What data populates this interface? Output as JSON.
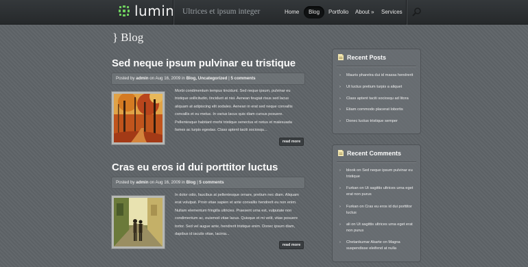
{
  "header": {
    "logo": "lumin",
    "tagline": "Ultrices et ipsum integer",
    "nav": [
      "Home",
      "Blog",
      "Portfolio",
      "About »",
      "Services"
    ],
    "active_nav": "Blog",
    "search_icon": "magnifier-icon"
  },
  "page": {
    "brace": "}",
    "title": "Blog"
  },
  "posts": [
    {
      "title": "Sed neque ipsum pulvinar eu tristique",
      "meta": {
        "posted_by": "Posted by",
        "author": "admin",
        "on": "on Aug 16, 2009 in",
        "categories": "Blog, Uncategorized",
        "sep": "|",
        "comments": "5 comments"
      },
      "excerpt": [
        "Morbi condimentum tempus tincidunt. Sed neque ipsum, pulvinar eu",
        "tristique sollicitudin, tincidunt at nisi. Aenean feugiat risus sed lacus",
        "aliquam at adipiscing elit sodales. Aenean in erat sed neque convallis",
        "convallis et eu metus. In varius lacus quis diam cursus posuere.",
        "Pellentesque habitant morbi tristique senectus et netus et malesuada",
        "fames ac turpis egestas. Class aptent taciti sociosqu..."
      ],
      "read_more": "read more",
      "thumb": "autumn-forest-image"
    },
    {
      "title": "Cras eu eros id dui porttitor luctus",
      "meta": {
        "posted_by": "Posted by",
        "author": "admin",
        "on": "on Aug 16, 2009 in",
        "categories": "Blog",
        "sep": "|",
        "comments": "5 comments"
      },
      "excerpt": [
        "In dolor odio, faucibus at pellentesque ornare, pretium nec diam. Aliquam",
        "erat volutpat. Proin vitae sapien et ante convallis hendrerit eu non enim.",
        "Nullam elementum fringilla ultricies. Praesent urna est, vulputate non",
        "condimentum ac, euismod vitae lacus. Quisque et mi velit, vitae posuere",
        "tortor. Sed vel augue ante, hendrerit tristique enim. Donec ipsum diam,",
        "dapibus id iaculis vitae, lacinia..."
      ],
      "read_more": "read more",
      "thumb": "couple-walking-alley-image"
    }
  ],
  "sidebar": {
    "recent_posts": {
      "title": "Recent Posts",
      "items": [
        "Mauris pharetra dui id massa hendrerit",
        "Ut luctus pretium turpis a aliquet",
        "Class aptent taciti sociosqu ad litora",
        "Etiam commodo placerat lobortis",
        "Donec luctus tristique semper"
      ]
    },
    "recent_comments": {
      "title": "Recent Comments",
      "items": [
        [
          "blook on Sed neque ipsum pulvinar eu",
          "tristique"
        ],
        [
          "Furkan on Ut sagittis ultrices urna eget",
          "erat non purus"
        ],
        [
          "Furkan on Cras eu eros id dui porttitor",
          "luctus"
        ],
        [
          "ali on Ut sagittis ultrices urna eget erat",
          "non purus"
        ],
        [
          "Chetankumar Akarte on Magna",
          "suspendisse eleifend at nulla"
        ]
      ]
    }
  },
  "colors": {
    "header_bg": "#2c2f31",
    "page_bg": "#5f6468",
    "logo_accent": "#7bd36a"
  }
}
